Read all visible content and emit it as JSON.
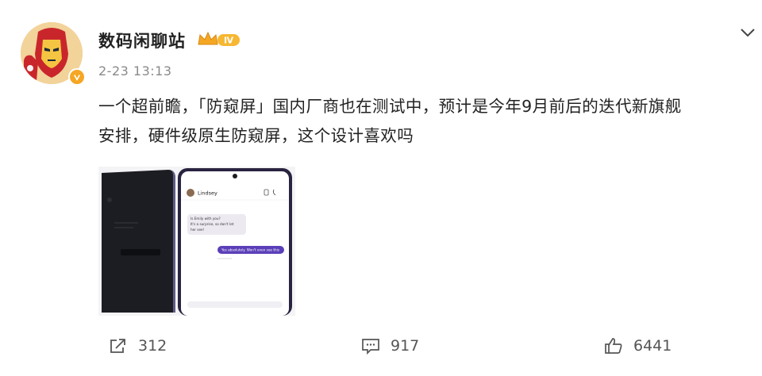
{
  "post": {
    "username": "数码闲聊站",
    "vip_level": "Ⅳ",
    "timestamp": "2-23 13:13",
    "text_line1": "一个超前瞻，「防窥屏」国内厂商也在测试中，预计是今年9月前后的迭代新旗舰",
    "text_line2": "安排，硬件级原生防窥屏，这个设计喜欢吗"
  },
  "image": {
    "contact_name": "Lindsey",
    "msg_in_line1": "Is Emily with you?",
    "msg_in_line2": "It's a surprise, so don't let",
    "msg_in_line3": "her see!",
    "msg_out": "Yes absolutely. Won't even see this"
  },
  "actions": {
    "repost_count": "312",
    "comment_count": "917",
    "like_count": "6441"
  },
  "icons": {
    "avatar": "iron-man-avatar",
    "verify": "verified-badge-icon",
    "vip": "crown-vip-icon",
    "more": "chevron-down-icon",
    "repost": "share-icon",
    "comment": "comment-icon",
    "like": "thumbs-up-icon"
  },
  "colors": {
    "accent_gold": "#f5a623",
    "text_primary": "#222222",
    "text_secondary": "#8a8a8a",
    "chat_purple": "#5b3fb8"
  }
}
